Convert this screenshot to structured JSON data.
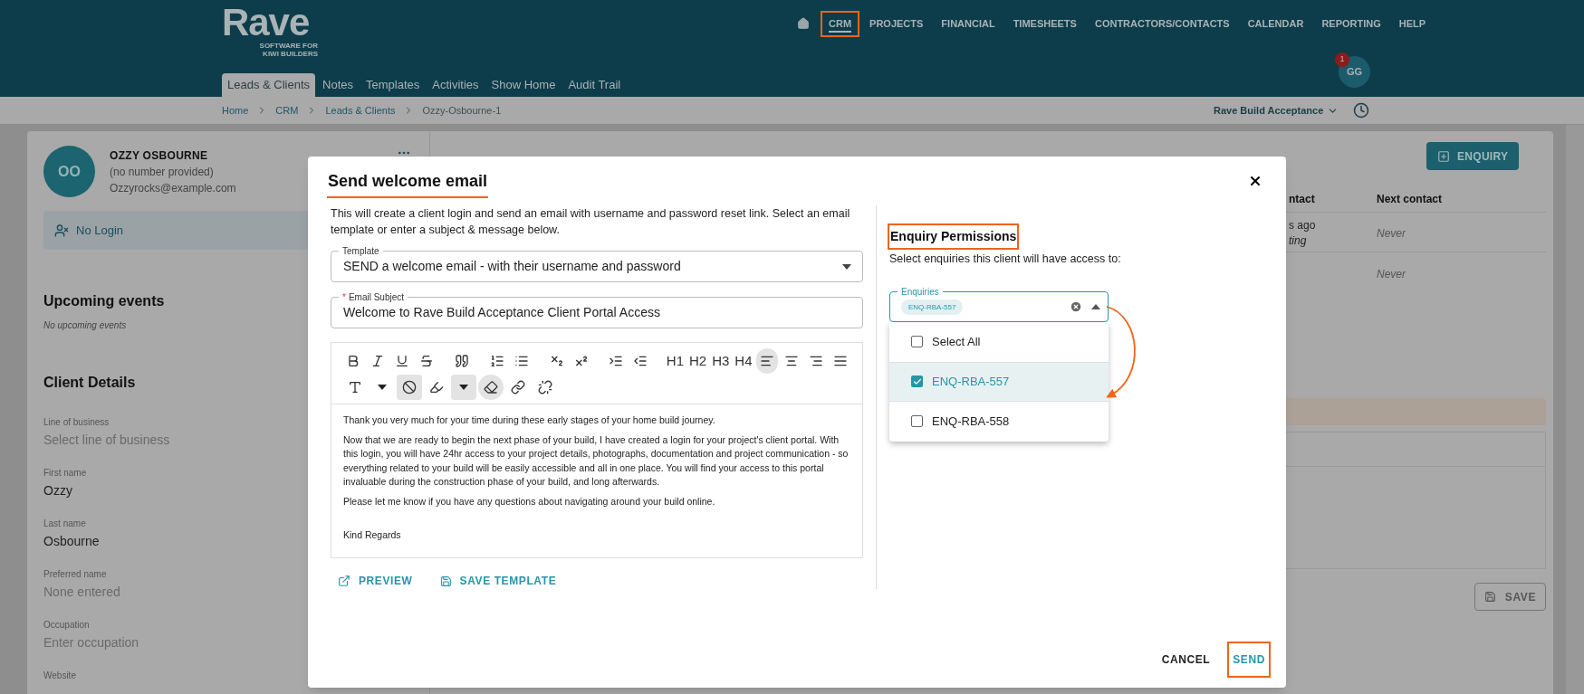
{
  "header": {
    "logo": "Rave",
    "tagline": "SOFTWARE FOR KIWI BUILDERS",
    "nav": [
      {
        "label": "CRM",
        "selected": true,
        "highlighted": true
      },
      {
        "label": "PROJECTS",
        "selected": false,
        "highlighted": false
      },
      {
        "label": "FINANCIAL",
        "selected": false,
        "highlighted": false
      },
      {
        "label": "TIMESHEETS",
        "selected": false,
        "highlighted": false
      },
      {
        "label": "CONTRACTORS/CONTACTS",
        "selected": false,
        "highlighted": false
      },
      {
        "label": "CALENDAR",
        "selected": false,
        "highlighted": false
      },
      {
        "label": "REPORTING",
        "selected": false,
        "highlighted": false
      },
      {
        "label": "HELP",
        "selected": false,
        "highlighted": false
      }
    ],
    "subtabs": [
      {
        "label": "Leads & Clients",
        "selected": true
      },
      {
        "label": "Notes",
        "selected": false
      },
      {
        "label": "Templates",
        "selected": false
      },
      {
        "label": "Activities",
        "selected": false
      },
      {
        "label": "Show Home",
        "selected": false
      },
      {
        "label": "Audit Trail",
        "selected": false
      }
    ],
    "user": {
      "initials": "GG",
      "badge": "1"
    }
  },
  "breadcrumb": {
    "items": [
      "Home",
      "CRM",
      "Leads & Clients",
      "Ozzy-Osbourne-1"
    ],
    "company": "Rave Build Acceptance"
  },
  "client": {
    "initials": "OO",
    "name": "OZZY OSBOURNE",
    "phone": "(no number provided)",
    "email": "Ozzyrocks@example.com",
    "login_status": "No Login",
    "events_title": "Upcoming events",
    "events_empty": "No upcoming events",
    "details_title": "Client Details",
    "fields": [
      {
        "label": "Line of business",
        "placeholder": "Select line of business"
      },
      {
        "label": "First name",
        "value": "Ozzy"
      },
      {
        "label": "Last name",
        "value": "Osbourne"
      },
      {
        "label": "Preferred name",
        "placeholder": "None entered"
      },
      {
        "label": "Occupation",
        "placeholder": "Enter occupation"
      },
      {
        "label": "Website"
      }
    ]
  },
  "background": {
    "enquiry_button": "ENQUIRY",
    "columns": [
      "ntact",
      "Next contact"
    ],
    "rows": [
      {
        "column_1": "s ago",
        "column_1b": "ting",
        "next": "Never"
      },
      {
        "next": "Never"
      }
    ],
    "save_button": "SAVE"
  },
  "dialog": {
    "title": "Send welcome email",
    "title_highlighted": true,
    "intro": "This will create a client login and send an email with username and password reset link. Select an email template or enter a subject & message below.",
    "template": {
      "label": "Template",
      "value": "SEND a welcome email - with their username and password"
    },
    "subject": {
      "label": "Email Subject",
      "required_mark": "*",
      "value": "Welcome to Rave Build Acceptance Client Portal Access"
    },
    "toolbar": [
      {
        "kind": "bold",
        "active": false
      },
      {
        "kind": "italic",
        "active": false
      },
      {
        "kind": "underline",
        "active": false
      },
      {
        "kind": "strike",
        "active": false
      },
      {
        "kind": "quote",
        "active": false
      },
      {
        "kind": "ordered",
        "active": false
      },
      {
        "kind": "bullets",
        "active": false
      },
      {
        "kind": "subscript",
        "active": false
      },
      {
        "kind": "superscript",
        "active": false
      },
      {
        "kind": "indent",
        "active": false
      },
      {
        "kind": "outdent",
        "active": false
      },
      {
        "kind": "heading",
        "label": "H1",
        "active": false
      },
      {
        "kind": "heading",
        "label": "H2",
        "active": false
      },
      {
        "kind": "heading",
        "label": "H3",
        "active": false
      },
      {
        "kind": "heading",
        "label": "H4",
        "active": false
      },
      {
        "kind": "align-left",
        "active": true
      },
      {
        "kind": "align-center",
        "active": false
      },
      {
        "kind": "align-right",
        "active": false
      },
      {
        "kind": "justify",
        "active": false
      },
      {
        "kind": "font",
        "active": false
      },
      {
        "kind": "caret",
        "active": false
      },
      {
        "kind": "none",
        "active": true
      },
      {
        "kind": "highlight",
        "active": false
      },
      {
        "kind": "caret",
        "active": true
      },
      {
        "kind": "eraser",
        "active": true
      },
      {
        "kind": "link",
        "active": false
      },
      {
        "kind": "unlink",
        "active": false
      }
    ],
    "body": [
      "Thank you very much for your time during these early stages of your home build journey.",
      "Now that we are ready to begin the next phase of your build, I have created a login for your project's client portal. With this login, you will have 24hr access to your project details, photographs, documentation and project communication - so everything related to your build will be easily accessible and all in one place. You will find your access to this portal invaluable during the construction phase of your build, and long afterwards.",
      "Please let me know if you have any questions about navigating around your build online.",
      "Kind Regards"
    ],
    "preview_button": "PREVIEW",
    "save_template_button": "SAVE TEMPLATE",
    "permissions": {
      "title": "Enquiry Permissions",
      "title_highlighted": true,
      "subtitle": "Select enquiries this client will have access to:",
      "field_label": "Enquiries",
      "chips": [
        "ENQ-RBA-557"
      ],
      "expanded": true,
      "options": [
        {
          "label": "Select All",
          "checked": false,
          "selected": false
        },
        {
          "label": "ENQ-RBA-557",
          "checked": true,
          "selected": true
        },
        {
          "label": "ENQ-RBA-558",
          "checked": false,
          "selected": false
        }
      ]
    },
    "cancel_button": "CANCEL",
    "send_button": {
      "label": "SEND",
      "highlighted": true
    }
  }
}
